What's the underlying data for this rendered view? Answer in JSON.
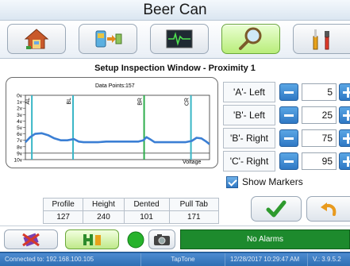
{
  "window": {
    "title": "Beer Can"
  },
  "nav": {
    "buttons": [
      {
        "name": "home",
        "icon": "house-icon"
      },
      {
        "name": "transfer",
        "icon": "transfer-icon"
      },
      {
        "name": "waveform",
        "icon": "waveform-icon"
      },
      {
        "name": "inspect",
        "icon": "magnifier-icon",
        "active": true
      },
      {
        "name": "tools",
        "icon": "tools-icon"
      }
    ]
  },
  "section": {
    "title": "Setup Inspection Window - Proximity 1"
  },
  "chart": {
    "data_points_label": "Data Points:",
    "data_points_value": "157",
    "series_label": "Voltage"
  },
  "chart_data": {
    "type": "line",
    "ylabel": "",
    "y_ticks": [
      "0v",
      "1v",
      "2v",
      "3v",
      "4v",
      "5v",
      "6v",
      "7v",
      "8v",
      "9v",
      "10v"
    ],
    "ylim": [
      10,
      0
    ],
    "markers": [
      {
        "label": "AL",
        "x": 8,
        "color": "#39b6c6"
      },
      {
        "label": "BL",
        "x": 59,
        "color": "#39b6c6"
      },
      {
        "label": "BR",
        "x": 147,
        "color": "#2eae4c"
      },
      {
        "label": "CR",
        "x": 205,
        "color": "#39b6c6"
      }
    ],
    "series": [
      {
        "name": "Voltage",
        "color": "#3b7fd4",
        "x": [
          0,
          6,
          12,
          20,
          28,
          36,
          44,
          52,
          60,
          66,
          72,
          80,
          90,
          100,
          110,
          120,
          130,
          140,
          146,
          150,
          154,
          160,
          170,
          180,
          190,
          198,
          206,
          212,
          218,
          224,
          228
        ],
        "values": [
          7.3,
          6.5,
          6.0,
          5.9,
          6.2,
          6.7,
          7.0,
          7.0,
          6.8,
          7.2,
          7.3,
          7.3,
          7.3,
          7.2,
          7.2,
          7.2,
          7.2,
          7.2,
          7.0,
          6.5,
          6.8,
          7.3,
          7.3,
          7.3,
          7.3,
          7.3,
          7.1,
          6.6,
          6.7,
          7.2,
          7.6
        ]
      }
    ]
  },
  "controls": [
    {
      "label": "'A'- Left",
      "value": "5"
    },
    {
      "label": "'B'- Left",
      "value": "25"
    },
    {
      "label": "'B'- Right",
      "value": "75"
    },
    {
      "label": "'C'- Right",
      "value": "95"
    }
  ],
  "show_markers": {
    "label": "Show Markers",
    "checked": true
  },
  "stats": {
    "headers": [
      "Profile",
      "Height",
      "Dented",
      "Pull Tab"
    ],
    "values": [
      "127",
      "240",
      "101",
      "171"
    ]
  },
  "actions": {
    "accept_icon": "checkmark-icon",
    "undo_icon": "undo-arrow-icon"
  },
  "bottom": {
    "alarm_text": "No Alarms"
  },
  "status": {
    "connection": "Connected to: 192.168.100.105",
    "app": "TapTone",
    "datetime": "12/28/2017 10:29:47 AM",
    "version": "V.: 3.9.5.2"
  }
}
